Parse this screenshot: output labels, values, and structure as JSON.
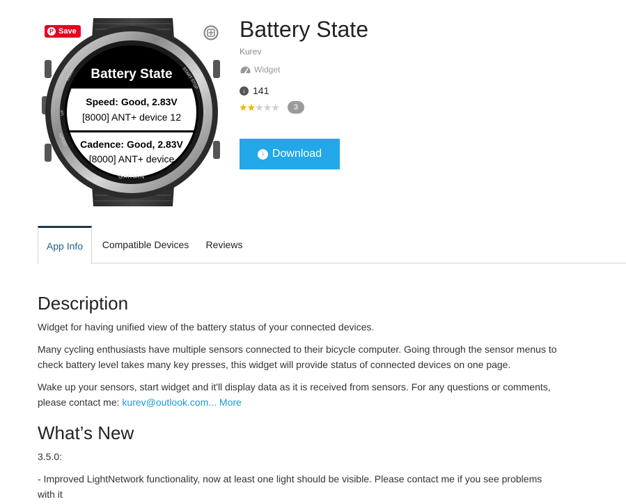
{
  "pin_save_label": "Save",
  "watch_screen": {
    "title": "Battery State",
    "row1_line1": "Speed: Good, 2.83V",
    "row1_line2": "[8000]  ANT+ device 12",
    "row2_line1": "Cadence: Good, 2.83V",
    "row2_line2": "[8000]  ANT+ device",
    "brand": "GARMIN",
    "bezel_labels": [
      "LIGHT",
      "UP",
      "DOWN",
      "START",
      "STOP"
    ]
  },
  "app": {
    "title": "Battery State",
    "author": "Kurev",
    "type": "Widget",
    "downloads": "141",
    "rating": 2,
    "rating_max": 5,
    "review_count": "3",
    "download_label": "Download"
  },
  "tabs": [
    {
      "label": "App Info",
      "active": true
    },
    {
      "label": "Compatible Devices",
      "active": false
    },
    {
      "label": "Reviews",
      "active": false
    }
  ],
  "description": {
    "heading": "Description",
    "para1": "Widget for having unified view of the battery status of your connected devices.",
    "para2": "Many cycling enthusiasts have multiple sensors connected to their bicycle computer. Going through the sensor menus to check battery level takes many key presses, this widget will provide status of connected devices on one page.",
    "para3_text": "Wake up your sensors, start widget and it'll display data as it is received from sensors. For any questions or comments, please contact me: ",
    "email": "kurev@outlook.com",
    "ellipsis": "...",
    "more_label": "More"
  },
  "whats_new": {
    "heading": "What’s New",
    "version": "3.5.0:",
    "note": "- Improved LightNetwork functionality, now at least one light should be visible. Please contact me if you see problems with it"
  },
  "colors": {
    "accent": "#22a7e8",
    "link": "#1a9ad6",
    "pinterest": "#e60023",
    "star": "#e6b800",
    "active_tab_border": "#1f3a4d"
  }
}
